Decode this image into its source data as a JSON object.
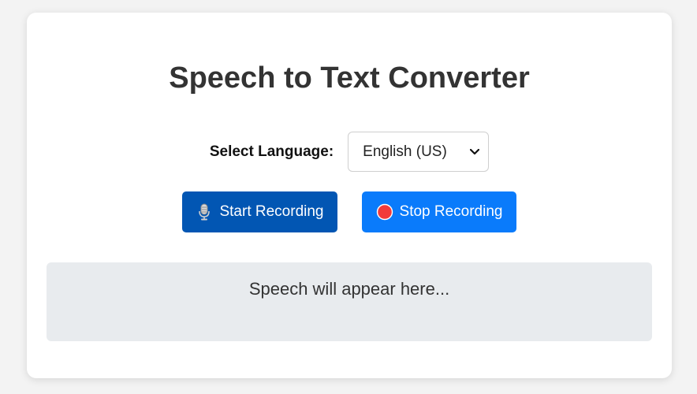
{
  "app": {
    "title": "Speech to Text Converter"
  },
  "language": {
    "label": "Select Language:",
    "selected": "English (US)"
  },
  "buttons": {
    "start_label": "Start Recording",
    "start_icon": "microphone-icon",
    "stop_label": "Stop Recording",
    "stop_icon": "red-circle-icon"
  },
  "output": {
    "placeholder_text": "Speech will appear here..."
  },
  "colors": {
    "start_button": "#0256b3",
    "stop_button": "#0a7bfb",
    "output_background": "#e8ebee",
    "stop_icon": "#f23a3a"
  }
}
